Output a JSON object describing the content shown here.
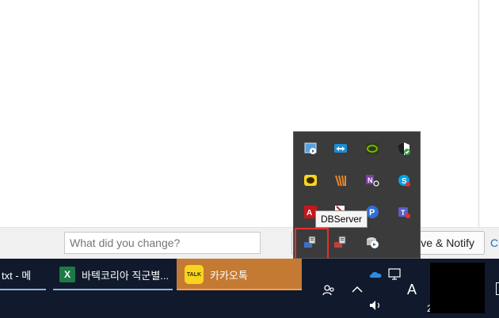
{
  "commit": {
    "message_placeholder": "What did you change?",
    "save_button_label": "ve & Notify",
    "cancel_label": "C"
  },
  "tray": {
    "tooltip": "DBServer",
    "icons": [
      "media-player-icon",
      "teamviewer-icon",
      "nvidia-icon",
      "security-shield-icon",
      "kakao-chat-icon",
      "vegas-icon",
      "onenote-clip-icon",
      "skype-icon",
      "adobe-icon",
      "adobe-updater-icon",
      "p-app-icon",
      "teams-icon",
      "dbserver-icon",
      "dbserver-alt-icon",
      "backup-icon"
    ]
  },
  "taskbar": {
    "items": [
      {
        "label": "txt - 메"
      },
      {
        "label": "바텍코리아 직군별..."
      },
      {
        "label": "카카오톡"
      }
    ],
    "kakao_icon_text": "TALK",
    "excel_icon_text": "X",
    "ime_label": "A",
    "clock_partial": "2"
  },
  "colors": {
    "taskbar_bg": "#101a2c",
    "kakao_active": "#c47a32",
    "highlight_border": "#e53030"
  }
}
